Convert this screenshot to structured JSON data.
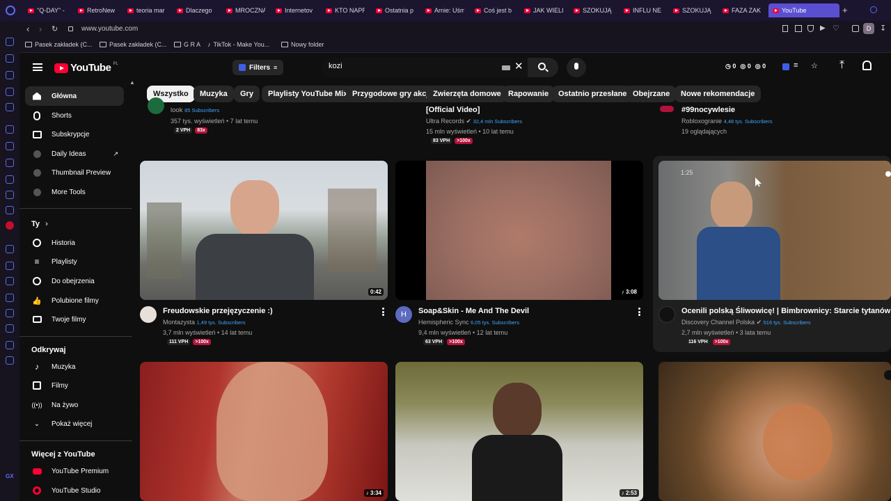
{
  "browser": {
    "tabs": [
      {
        "label": "\"Q-DAY\" -"
      },
      {
        "label": "RetroNew"
      },
      {
        "label": "teoria mar"
      },
      {
        "label": "Dlaczego"
      },
      {
        "label": "MROCZNA"
      },
      {
        "label": "Internetov"
      },
      {
        "label": "KTO NAPR"
      },
      {
        "label": "Ostatnia p"
      },
      {
        "label": "Arnie: Uśm"
      },
      {
        "label": "Coś jest b"
      },
      {
        "label": "JAK WIELI"
      },
      {
        "label": "SZOKUJĄ"
      },
      {
        "label": "INFLU NE"
      },
      {
        "label": "SZOKUJĄ"
      },
      {
        "label": "FAZA ZAK"
      },
      {
        "label": "YouTube"
      }
    ],
    "url": "www.youtube.com",
    "profile_initial": "D",
    "bookmarks": [
      {
        "label": "Pasek zakładek (C..."
      },
      {
        "label": "Pasek zakładek (C..."
      },
      {
        "label": "G R A"
      },
      {
        "label": "TikTok - Make You..."
      },
      {
        "label": "Nowy folder"
      }
    ]
  },
  "masthead": {
    "logo": "YouTube",
    "country": "PL",
    "filters_label": "Filters",
    "search_value": "kozi",
    "counters": [
      "0",
      "0",
      "0"
    ]
  },
  "chips": [
    "Wszystko",
    "Muzyka",
    "Gry",
    "Playlisty YouTube Mix",
    "Przygodowe gry akcji",
    "Zwierzęta domowe",
    "Rapowanie",
    "Ostatnio przesłane",
    "Obejrzane",
    "Nowe rekomendacje"
  ],
  "nav": {
    "main": [
      "Główna",
      "Shorts",
      "Subskrypcje"
    ],
    "tools": [
      "Daily Ideas",
      "Thumbnail Preview",
      "More Tools"
    ],
    "you_header": "Ty",
    "you": [
      "Historia",
      "Playlisty",
      "Do obejrzenia",
      "Polubione filmy",
      "Twoje filmy"
    ],
    "explore_header": "Odkrywaj",
    "explore": [
      "Muzyka",
      "Filmy",
      "Na żywo",
      "Pokaż więcej"
    ],
    "more_header": "Więcej z YouTube",
    "more": [
      "YouTube Premium",
      "YouTube Studio"
    ]
  },
  "top_row": [
    {
      "channel": "look",
      "subs": "85 Subscribers",
      "meta": "357 tys. wyświetleń • 7 lat temu",
      "vph": "2 VPH",
      "badge": "83x"
    },
    {
      "title": "[Official Video]",
      "channel": "Ultra Records",
      "subs": "32,4 mln Subscribers",
      "meta": "15 mln wyświetleń • 10 lat temu",
      "vph": "83 VPH",
      "badge": ">100x"
    },
    {
      "title": "#99nocywlesie",
      "channel": "Robloxogranie",
      "subs": "4,48 tys. Subscribers",
      "meta": "19 oglądających"
    }
  ],
  "videos": [
    {
      "title": "Freudowskie przejęzyczenie :)",
      "channel": "Montazysta",
      "subs": "1,49 tys. Subscribers",
      "meta": "3,7 mln wyświetleń • 14 lat temu",
      "vph": "111 VPH",
      "badge": ">100x",
      "duration": "0:42"
    },
    {
      "title": "Soap&Skin - Me And The Devil",
      "channel": "Hemispheric Sync",
      "avatar_letter": "H",
      "subs": "6,05 tys. Subscribers",
      "meta": "9,4 mln wyświetleń • 12 lat temu",
      "vph": "63 VPH",
      "badge": ">100x",
      "duration": "3:08"
    },
    {
      "title": "Ocenili polską Śliwowicę! | Bimbrownicy: Starcie tytanów",
      "channel": "Discovery Channel Polska",
      "subs": "516 tys. Subscribers",
      "meta": "2,7 mln wyświetleń • 3 lata temu",
      "vph": "116 VPH",
      "badge": ">100x",
      "duration": "1:25"
    },
    {
      "duration": "3:34"
    },
    {
      "duration": "2:53"
    },
    {}
  ]
}
